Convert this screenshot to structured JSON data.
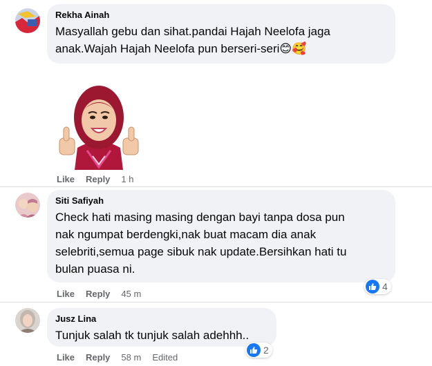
{
  "comments": [
    {
      "author": "Rekha Ainah",
      "text_line1": "Masyallah gebu dan sihat.pandai Hajah Neelofa jaga",
      "text_line2": "anak.Wajah Hajah Neelofa pun berseri-seri😊🥰",
      "sticker": "thumbs-up-hijab-avatar-sticker",
      "like_label": "Like",
      "reply_label": "Reply",
      "time": "1 h"
    },
    {
      "author": "Siti Safiyah",
      "text_lines": [
        "Check hati masing masing dengan bayi tanpa dosa pun",
        "nak ngumpat berdengki,nak buat macam dia anak",
        "selebriti,semua page sibuk nak update.Bersihkan hati tu",
        "bulan puasa ni."
      ],
      "like_label": "Like",
      "reply_label": "Reply",
      "time": "45 m",
      "reaction_icon": "like-icon",
      "reaction_count": "4"
    },
    {
      "author": "Jusz Lina",
      "text": "Tunjuk salah tk tunjuk salah adehhh..",
      "like_label": "Like",
      "reply_label": "Reply",
      "time": "58 m",
      "edited_label": "Edited",
      "reaction_icon": "like-icon",
      "reaction_count": "2"
    }
  ],
  "colors": {
    "bubble": "#f0f2f5",
    "meta_text": "#65676b",
    "like_blue": "#1877f2",
    "separator": "#dadde1"
  }
}
